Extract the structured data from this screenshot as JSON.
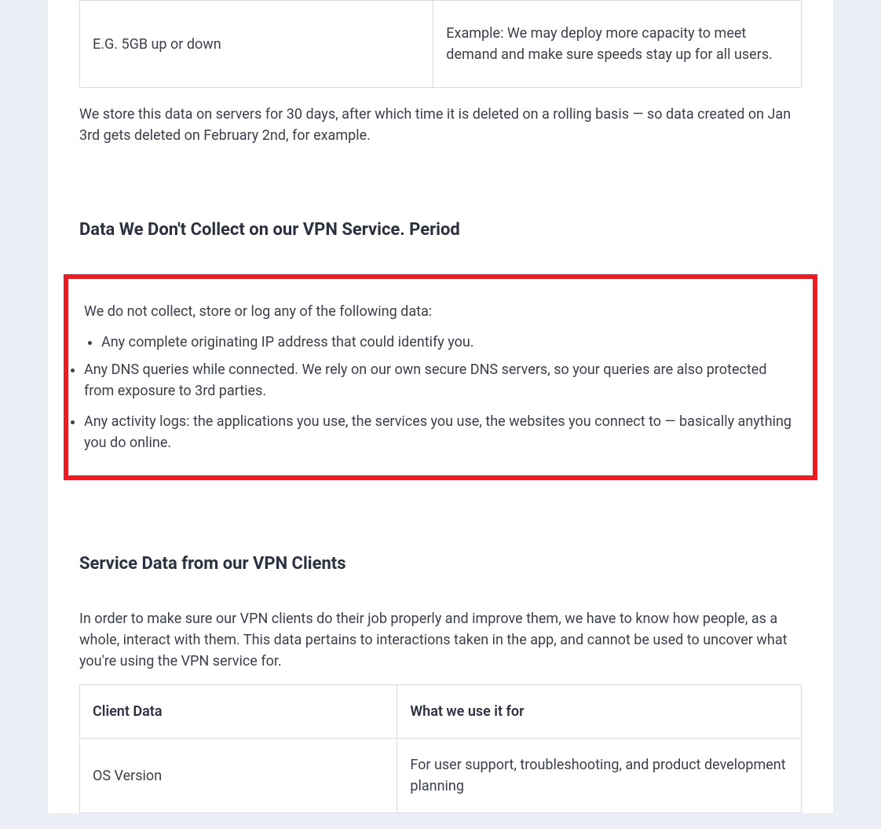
{
  "table1": {
    "row": {
      "col1": "E.G. 5GB up or down",
      "col2": "Example: We may deploy more capacity to meet demand and make sure speeds stay up for all users."
    }
  },
  "storage_text": "We store this data on servers for 30 days, after which time it is deleted on a rolling basis — so data created on Jan 3rd gets deleted on February 2nd, for example.",
  "heading_not_collect": "Data We Don't Collect on our VPN Service. Period",
  "not_collect_intro": "We do not collect, store or log any of the following data:",
  "not_collect_items": {
    "item1": "Any complete originating IP address that could identify you.",
    "item2": "Any DNS queries while connected. We rely on our own secure DNS servers, so your queries are also protected from exposure to 3rd parties.",
    "item3": "Any activity logs: the applications you use, the services you use, the websites you connect to — basically anything you do online."
  },
  "heading_service_data": "Service Data from our VPN Clients",
  "service_data_intro": "In order to make sure our VPN clients do their job properly and improve them, we have to know how people, as a whole, interact with them. This data pertains to interactions taken in the app, and cannot be used to uncover what you're using the VPN service for.",
  "table2": {
    "header": {
      "col1": "Client Data",
      "col2": "What we use it for"
    },
    "row1": {
      "col1": "OS Version",
      "col2": "For user support, troubleshooting, and product development planning"
    }
  }
}
